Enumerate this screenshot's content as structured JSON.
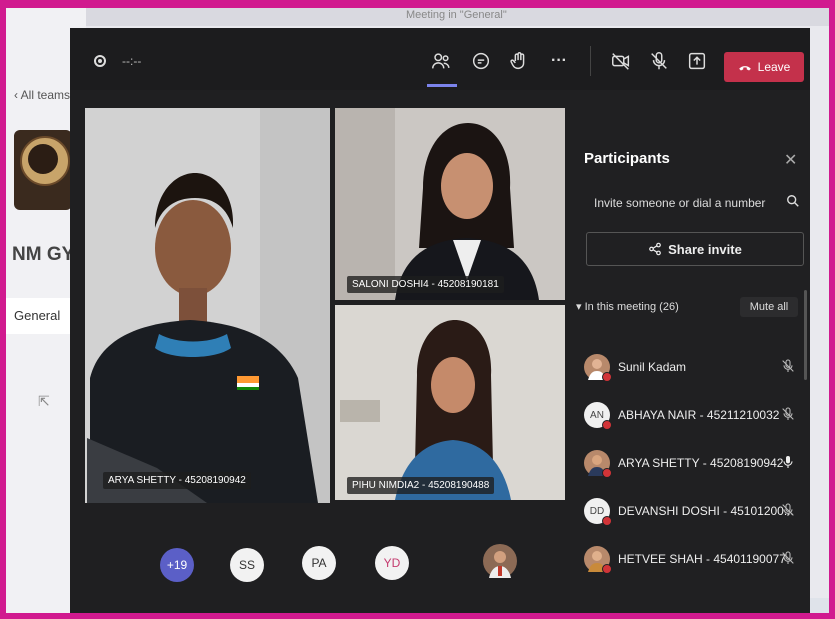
{
  "window_title": "Meeting in \"General\"",
  "background_app": {
    "back_link": "All teams",
    "team_name": "NM GYM",
    "channel": "General"
  },
  "toolbar": {
    "timer": "--:--",
    "leave_label": "Leave"
  },
  "videos": [
    {
      "name": "ARYA SHETTY - 45208190942"
    },
    {
      "name": "SALONI DOSHI4 - 45208190181"
    },
    {
      "name": "PIHU NIMDIA2 - 45208190488"
    }
  ],
  "stage_avatars": [
    {
      "label": "+19"
    },
    {
      "label": "SS"
    },
    {
      "label": "PA"
    },
    {
      "label": "YD"
    }
  ],
  "participants": {
    "title": "Participants",
    "search_placeholder": "Invite someone or dial a number",
    "share_label": "Share invite",
    "section_label": "In this meeting (26)",
    "mute_all_label": "Mute all",
    "items": [
      {
        "name": "Sunil Kadam",
        "initials": "",
        "muted": true
      },
      {
        "name": "ABHAYA NAIR - 45211210032",
        "initials": "AN",
        "muted": true
      },
      {
        "name": "ARYA SHETTY - 45208190942",
        "initials": "",
        "muted": false
      },
      {
        "name": "DEVANSHI DOSHI - 45101200...",
        "initials": "DD",
        "muted": true
      },
      {
        "name": "HETVEE SHAH - 45401190077",
        "initials": "",
        "muted": true
      }
    ]
  },
  "colors": {
    "frame": "#d11a8f",
    "leave_red": "#c4314b",
    "teams_purple": "#5b5fc7",
    "indicator": "#7b83eb"
  }
}
